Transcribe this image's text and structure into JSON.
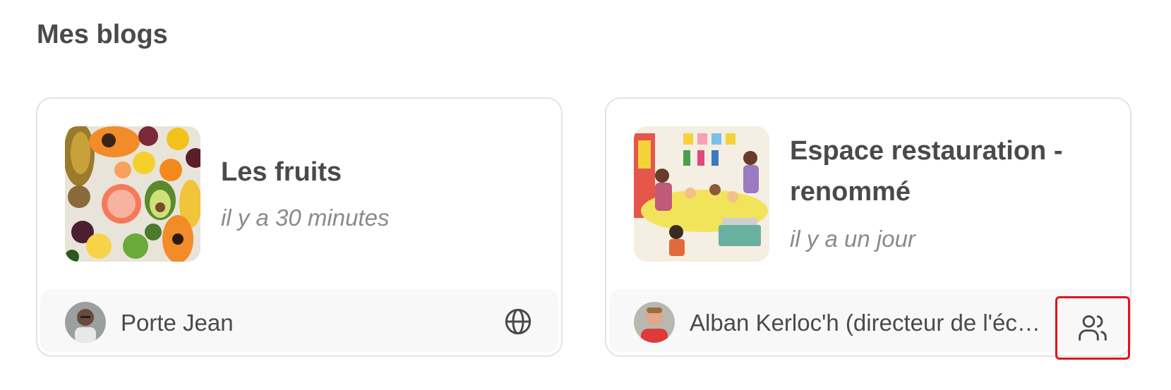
{
  "page": {
    "title": "Mes blogs"
  },
  "blogs": [
    {
      "title": "Les fruits",
      "time": "il y a 30 minutes",
      "author": "Porte Jean",
      "visibility_icon": "globe-icon"
    },
    {
      "title": "Espace restauration - renommé",
      "time": "il y a un jour",
      "author": "Alban Kerloc'h (directeur de l'éc…",
      "visibility_icon": "users-icon"
    }
  ],
  "colors": {
    "text": "#4a4a4a",
    "muted": "#8a8a8a",
    "border": "#e3e3e3",
    "footer_bg": "#f8f8f8",
    "highlight": "#e0131c"
  }
}
